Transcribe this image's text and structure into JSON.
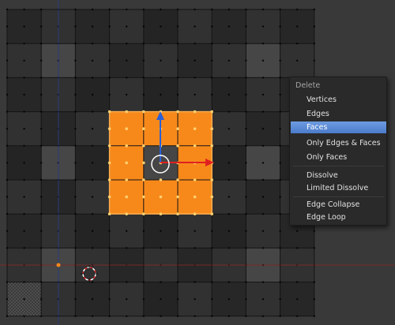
{
  "colors": {
    "background": "#393939",
    "cell_dark": "#272727",
    "cell_mid": "#313131",
    "cell_light": "#464646",
    "selected_face": "#f7891a",
    "accent_menu": "#5680c2",
    "axis_y": "#2a5fd8",
    "axis_x": "#e02020"
  },
  "context_menu": {
    "title": "Delete",
    "items": [
      {
        "label": "Vertices",
        "active": false
      },
      {
        "label": "Edges",
        "active": false
      },
      {
        "label": "Faces",
        "active": true
      },
      {
        "label": "Only Edges & Faces",
        "active": false
      },
      {
        "label": "Only Faces",
        "active": false
      },
      {
        "label": "Dissolve",
        "active": false
      },
      {
        "label": "Limited Dissolve",
        "active": false
      },
      {
        "label": "Edge Collapse",
        "active": false
      },
      {
        "label": "Edge Loop",
        "active": false
      }
    ]
  },
  "icons": {
    "manipulator": "transform-manipulator-icon",
    "cursor": "3d-cursor-icon"
  }
}
